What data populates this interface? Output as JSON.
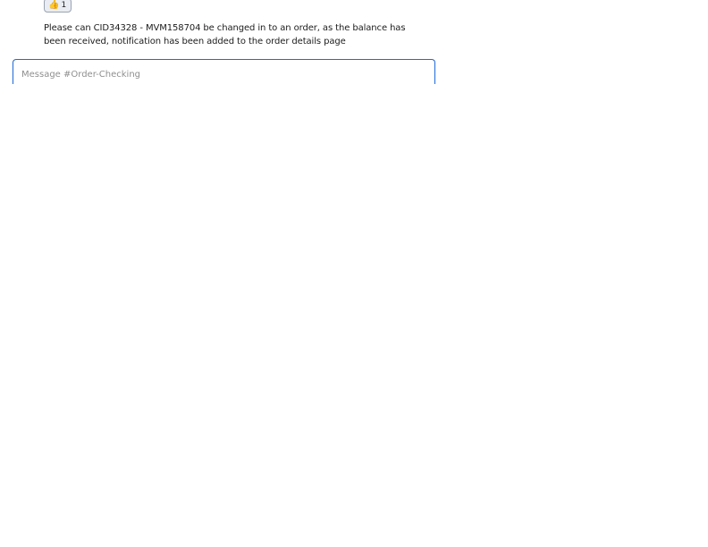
{
  "message": {
    "reaction": {
      "icon": "thumbs-up-icon",
      "glyph": "👍",
      "count": "1"
    },
    "text": "Please can CID34328 - MVM158704 be changed in to an order, as the balance has been received, notification has been added to the order details page"
  },
  "composer": {
    "placeholder": "Message #Order-Checking",
    "value": ""
  },
  "colors": {
    "focus_border": "#1d6ad6",
    "reaction_bg": "#e9edf3"
  }
}
